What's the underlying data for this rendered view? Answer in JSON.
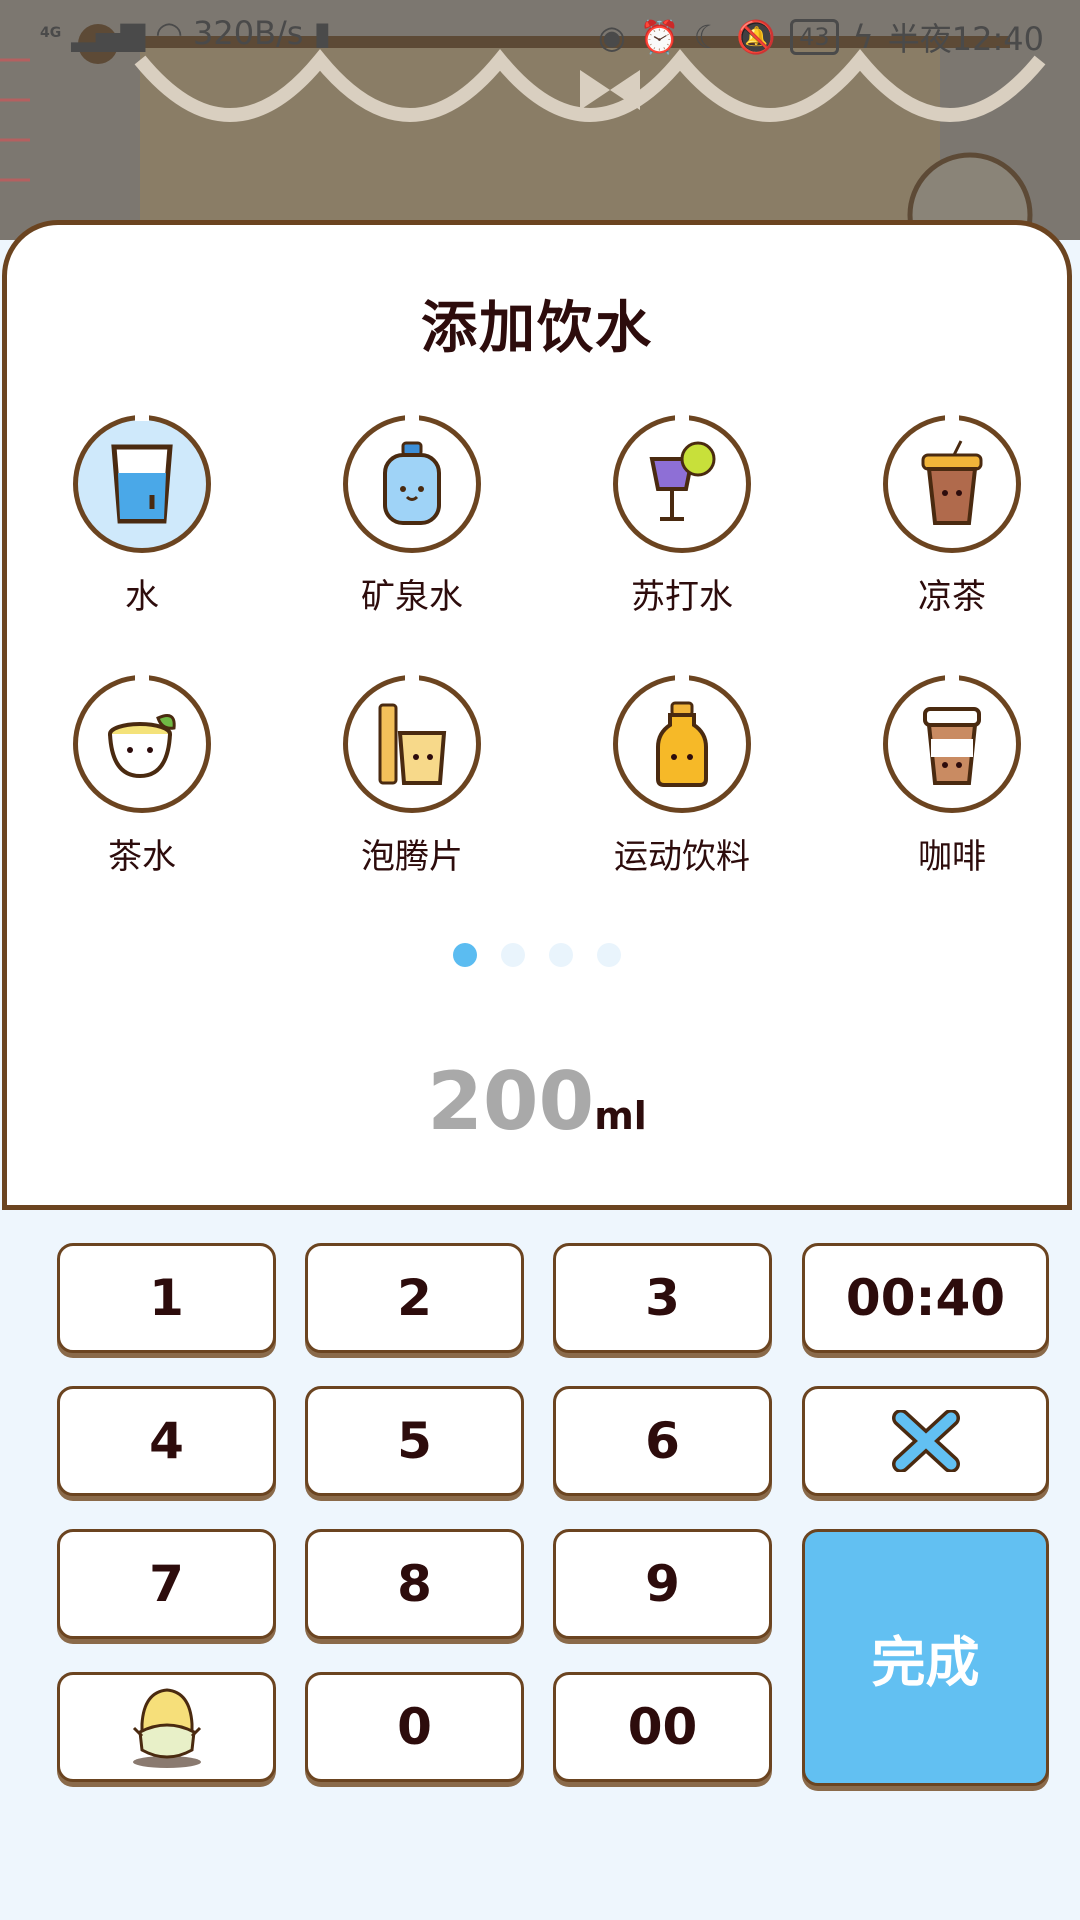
{
  "status_bar": {
    "network": "4G",
    "speed": "320B/s",
    "battery": "43",
    "time": "半夜12:40"
  },
  "dialog": {
    "title": "添加饮水",
    "drinks": [
      {
        "label": "水",
        "icon": "water-glass-icon",
        "selected": true
      },
      {
        "label": "矿泉水",
        "icon": "mineral-water-bottle-icon",
        "selected": false
      },
      {
        "label": "苏打水",
        "icon": "soda-cocktail-icon",
        "selected": false
      },
      {
        "label": "凉茶",
        "icon": "iced-tea-cup-icon",
        "selected": false
      },
      {
        "label": "茶水",
        "icon": "tea-bowl-icon",
        "selected": false
      },
      {
        "label": "泡腾片",
        "icon": "effervescent-tablet-icon",
        "selected": false
      },
      {
        "label": "运动饮料",
        "icon": "sports-drink-bottle-icon",
        "selected": false
      },
      {
        "label": "咖啡",
        "icon": "coffee-cup-icon",
        "selected": false
      }
    ],
    "pager": {
      "pages": 4,
      "active": 0
    },
    "amount": {
      "value": "200",
      "unit": "ml"
    }
  },
  "keypad": {
    "keys": [
      "1",
      "2",
      "3",
      "00:40",
      "4",
      "5",
      "6",
      "7",
      "8",
      "9",
      "0",
      "00"
    ],
    "done_label": "完成"
  },
  "colors": {
    "accent": "#62c0f2",
    "border_brown": "#6b4420",
    "text_dark": "#2d0c0c",
    "keypad_bg": "#eef6fd"
  }
}
